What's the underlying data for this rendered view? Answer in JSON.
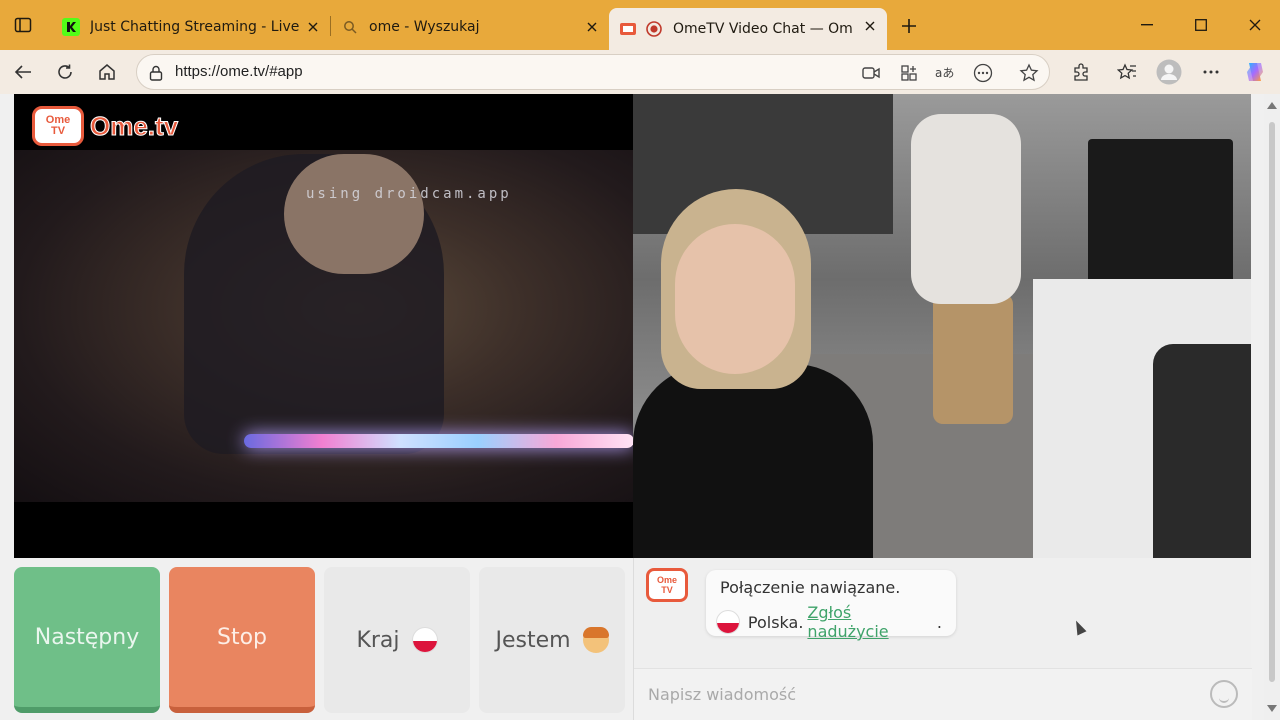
{
  "browser": {
    "tabs": [
      {
        "title": "Just Chatting Streaming - Live Str",
        "favicon": "kick-icon"
      },
      {
        "title": "ome - Wyszukaj",
        "favicon": "search-icon"
      },
      {
        "title": "OmeTV Video Chat — Omeg",
        "favicon": "ometv-icon",
        "active": true
      }
    ],
    "url": "https://ome.tv/#app"
  },
  "app": {
    "logo_top": "Ome",
    "logo_bottom": "TV",
    "logo_text": "Ome.tv",
    "watermark": "using droidcam.app",
    "controls": {
      "next_label": "Następny",
      "stop_label": "Stop",
      "country_label": "Kraj",
      "gender_label": "Jestem"
    },
    "chat": {
      "message_line1": "Połączenie nawiązane.",
      "country": "Polska.",
      "report_link": "Zgłoś nadużycie",
      "report_suffix": ".",
      "input_placeholder": "Napisz wiadomość"
    }
  },
  "colors": {
    "tabstrip": "#e8a93b",
    "next": "#6fbf88",
    "stop": "#e98560",
    "link": "#3fa36a",
    "brand": "#e85a3c"
  }
}
